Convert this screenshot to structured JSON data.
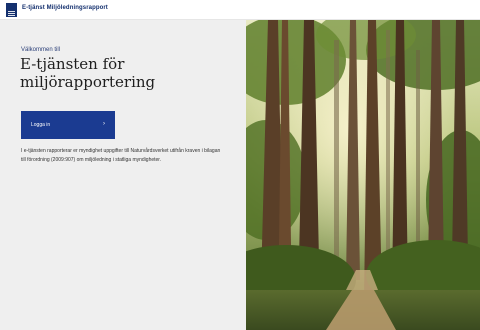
{
  "header": {
    "app_title": "E-tjänst Miljöledningsrapport",
    "logo_icon": "authority-logo-icon",
    "brand_color": "#14306e"
  },
  "main": {
    "welcome": "Välkommen till",
    "headline": "E-tjänsten för miljörapportering",
    "login_label": "Logga in",
    "login_icon": "chevron-right-icon",
    "description": "I e-tjänsten rapporterar er myndighet uppgifter till Naturvårdsverket utifrån kraven i bilagan till förordning (2009:907) om miljöledning i statliga myndigheter.",
    "accent_color": "#1b3b91"
  },
  "hero": {
    "image": "forest-photo"
  }
}
